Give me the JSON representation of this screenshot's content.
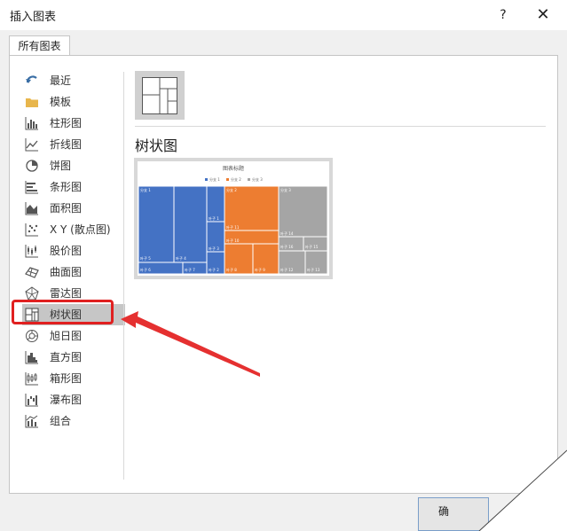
{
  "dialog": {
    "title": "插入图表",
    "help": "?",
    "close": "✕"
  },
  "tabs": [
    {
      "label": "所有图表"
    }
  ],
  "sidebar": {
    "items": [
      {
        "label": "最近",
        "icon": "recent-icon"
      },
      {
        "label": "模板",
        "icon": "folder-icon"
      },
      {
        "label": "柱形图",
        "icon": "column-chart-icon"
      },
      {
        "label": "折线图",
        "icon": "line-chart-icon"
      },
      {
        "label": "饼图",
        "icon": "pie-chart-icon"
      },
      {
        "label": "条形图",
        "icon": "bar-chart-icon"
      },
      {
        "label": "面积图",
        "icon": "area-chart-icon"
      },
      {
        "label": "X Y (散点图)",
        "icon": "scatter-chart-icon"
      },
      {
        "label": "股价图",
        "icon": "stock-chart-icon"
      },
      {
        "label": "曲面图",
        "icon": "surface-chart-icon"
      },
      {
        "label": "雷达图",
        "icon": "radar-chart-icon"
      },
      {
        "label": "树状图",
        "icon": "treemap-chart-icon",
        "selected": true
      },
      {
        "label": "旭日图",
        "icon": "sunburst-chart-icon"
      },
      {
        "label": "直方图",
        "icon": "histogram-chart-icon"
      },
      {
        "label": "箱形图",
        "icon": "box-chart-icon"
      },
      {
        "label": "瀑布图",
        "icon": "waterfall-chart-icon"
      },
      {
        "label": "组合",
        "icon": "combo-chart-icon"
      }
    ]
  },
  "main": {
    "selected_chart_name": "树状图",
    "preview": {
      "title": "图表标题",
      "legend": [
        {
          "label": "分支 1",
          "color": "#4472c4"
        },
        {
          "label": "分支 2",
          "color": "#ed7d31"
        },
        {
          "label": "分支 3",
          "color": "#a5a5a5"
        }
      ],
      "labels": {
        "branch1": "分支 1",
        "branch2": "分支 2",
        "branch3": "分支 3",
        "leaf1": "叶子 1",
        "leaf2": "叶子 2",
        "leaf3": "叶子 3",
        "leaf4": "叶子 4",
        "leaf5": "叶子 5",
        "leaf6": "叶子 6",
        "leaf7": "叶子 7",
        "leaf8": "叶子 8",
        "leaf9": "叶子 9",
        "leaf10": "叶子 10",
        "leaf11": "叶子 11",
        "leaf12": "叶子 12",
        "leaf13": "叶子 13",
        "leaf14": "叶子 14",
        "leaf15": "叶子 15",
        "leaf16": "叶子 16"
      }
    }
  },
  "footer": {
    "ok_label": "确"
  },
  "colors": {
    "accent_red": "#e02020",
    "selected_bg": "#c6c6c6"
  }
}
